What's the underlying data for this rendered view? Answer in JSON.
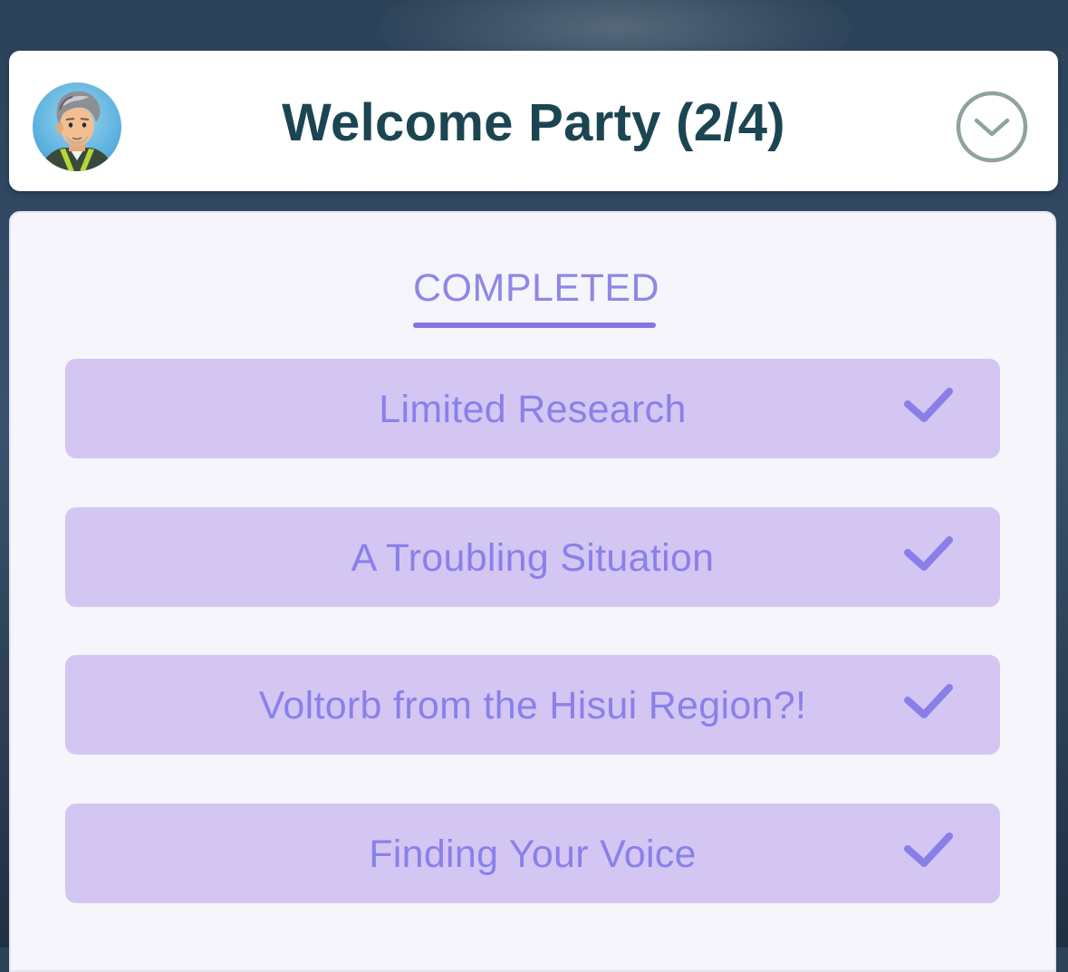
{
  "header": {
    "title": "Welcome Party (2/4)",
    "avatar_icon": "professor-willow-avatar",
    "collapse_icon": "chevron-down-circle-icon"
  },
  "tabs": [
    {
      "label": "COMPLETED",
      "active": true
    }
  ],
  "tasks": [
    {
      "label": "Limited Research",
      "completed": true,
      "icon": "checkmark-icon"
    },
    {
      "label": "A Troubling Situation",
      "completed": true,
      "icon": "checkmark-icon"
    },
    {
      "label": "Voltorb from the Hisui Region?!",
      "completed": true,
      "icon": "checkmark-icon"
    },
    {
      "label": "Finding Your Voice",
      "completed": true,
      "icon": "checkmark-icon"
    }
  ],
  "colors": {
    "title": "#1c4552",
    "accent": "#8376e4",
    "task_background": "#d3c6f3",
    "task_text": "#8a80ea",
    "panel_background": "#f5f5fb"
  }
}
